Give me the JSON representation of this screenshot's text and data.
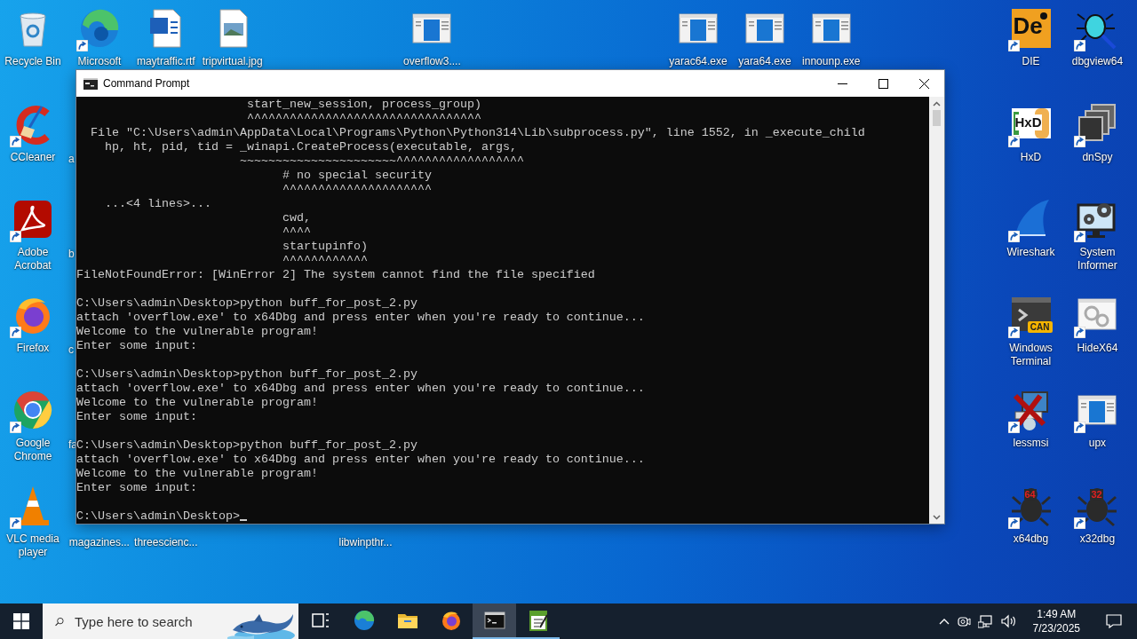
{
  "desktop": {
    "icons": [
      {
        "label": "Recycle Bin",
        "kind": "recycle-bin",
        "shortcut": false
      },
      {
        "label": "Microsoft",
        "kind": "edge",
        "shortcut": true
      },
      {
        "label": "maytraffic.rtf",
        "kind": "word-document",
        "shortcut": false
      },
      {
        "label": "tripvirtual.jpg",
        "kind": "image-file",
        "shortcut": false
      },
      {
        "label": "overflow3....",
        "kind": "app-window",
        "shortcut": false
      },
      {
        "label": "yarac64.exe",
        "kind": "app-window",
        "shortcut": false
      },
      {
        "label": "yara64.exe",
        "kind": "app-window",
        "shortcut": false
      },
      {
        "label": "innounp.exe",
        "kind": "app-window",
        "shortcut": false
      },
      {
        "label": "DIE",
        "kind": "die",
        "badge": "De",
        "shortcut": true
      },
      {
        "label": "dbgview64",
        "kind": "bug-magnifier",
        "shortcut": true
      },
      {
        "label": "CCleaner",
        "kind": "ccleaner",
        "shortcut": true
      },
      {
        "label": "a",
        "kind": "covered",
        "shortcut": false
      },
      {
        "label": "HxD",
        "kind": "hxd",
        "badge": "HxD",
        "shortcut": true
      },
      {
        "label": "dnSpy",
        "kind": "dnspy",
        "shortcut": true
      },
      {
        "label": "Adobe Acrobat",
        "kind": "acrobat",
        "shortcut": true
      },
      {
        "label": "b",
        "kind": "covered",
        "shortcut": false
      },
      {
        "label": "Wireshark",
        "kind": "wireshark",
        "shortcut": true
      },
      {
        "label": "System Informer",
        "kind": "system-informer",
        "shortcut": true
      },
      {
        "label": "Firefox",
        "kind": "firefox",
        "shortcut": true
      },
      {
        "label": "c",
        "kind": "covered",
        "shortcut": false
      },
      {
        "label": "Windows Terminal",
        "kind": "terminal",
        "badge": "CAN",
        "shortcut": true
      },
      {
        "label": "HideX64",
        "kind": "hidex",
        "shortcut": true
      },
      {
        "label": "Google Chrome",
        "kind": "chrome",
        "shortcut": true
      },
      {
        "label": "fa",
        "kind": "covered",
        "shortcut": false
      },
      {
        "label": "lessmsi",
        "kind": "lessmsi",
        "shortcut": true
      },
      {
        "label": "upx",
        "kind": "app-window",
        "shortcut": true
      },
      {
        "label": "VLC media player",
        "kind": "vlc",
        "shortcut": true
      },
      {
        "label": "magazines...",
        "kind": "label-only",
        "shortcut": false
      },
      {
        "label": "threescienc...",
        "kind": "label-only",
        "shortcut": false
      },
      {
        "label": "libwinpthr...",
        "kind": "label-only",
        "shortcut": false
      },
      {
        "label": "x64dbg",
        "kind": "bug",
        "badge": "64",
        "shortcut": true
      },
      {
        "label": "x32dbg",
        "kind": "bug",
        "badge": "32",
        "shortcut": true
      }
    ]
  },
  "window": {
    "title": "Command Prompt",
    "console": {
      "blocks": [
        [
          "                        start_new_session, process_group)",
          "                        ^^^^^^^^^^^^^^^^^^^^^^^^^^^^^^^^^",
          "  File \"C:\\Users\\admin\\AppData\\Local\\Programs\\Python\\Python314\\Lib\\subprocess.py\", line 1552, in _execute_child",
          "    hp, ht, pid, tid = _winapi.CreateProcess(executable, args,",
          "                       ~~~~~~~~~~~~~~~~~~~~~~^^^^^^^^^^^^^^^^^^",
          "                             # no special security",
          "                             ^^^^^^^^^^^^^^^^^^^^^",
          "    ...<4 lines>...",
          "                             cwd,",
          "                             ^^^^",
          "                             startupinfo)",
          "                             ^^^^^^^^^^^^",
          "FileNotFoundError: [WinError 2] The system cannot find the file specified"
        ],
        [
          "C:\\Users\\admin\\Desktop>python buff_for_post_2.py",
          "attach 'overflow.exe' to x64Dbg and press enter when you're ready to continue...",
          "Welcome to the vulnerable program!",
          "Enter some input:"
        ],
        [
          "C:\\Users\\admin\\Desktop>python buff_for_post_2.py",
          "attach 'overflow.exe' to x64Dbg and press enter when you're ready to continue...",
          "Welcome to the vulnerable program!",
          "Enter some input:"
        ],
        [
          "C:\\Users\\admin\\Desktop>python buff_for_post_2.py",
          "attach 'overflow.exe' to x64Dbg and press enter when you're ready to continue...",
          "Welcome to the vulnerable program!",
          "Enter some input:"
        ],
        [
          "C:\\Users\\admin\\Desktop>"
        ]
      ],
      "cursor": true
    }
  },
  "taskbar": {
    "search": {
      "placeholder": "Type here to search"
    },
    "apps": [
      {
        "kind": "task-view",
        "active": false,
        "running": false
      },
      {
        "kind": "edge",
        "active": false,
        "running": false
      },
      {
        "kind": "folder",
        "active": false,
        "running": false
      },
      {
        "kind": "firefox",
        "active": false,
        "running": false
      },
      {
        "kind": "console",
        "active": true,
        "running": true
      },
      {
        "kind": "notepad",
        "active": false,
        "running": true
      }
    ],
    "clock": {
      "time": "1:49 AM",
      "date": "7/23/2025"
    }
  }
}
